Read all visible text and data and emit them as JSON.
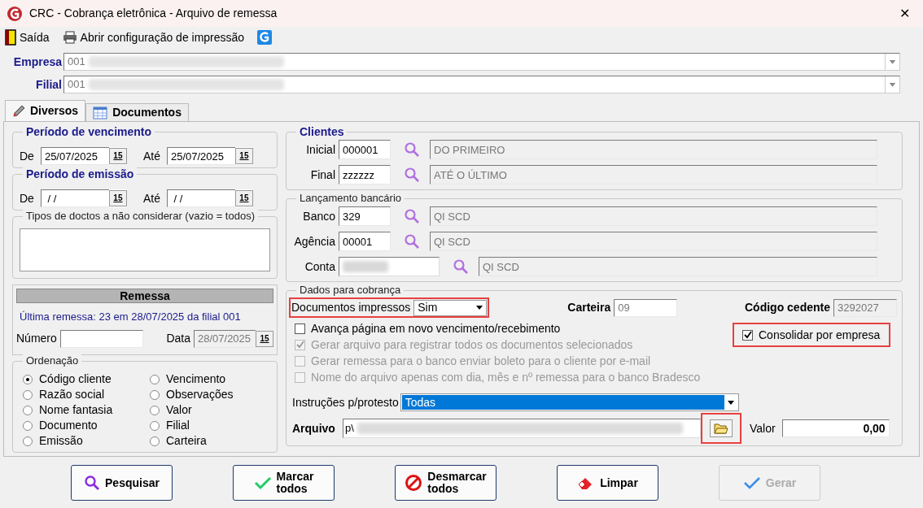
{
  "window": {
    "title": "CRC - Cobrança eletrônica - Arquivo de remessa",
    "close": "✕"
  },
  "toolbar": [
    {
      "kind": "exit",
      "label": "Saída"
    },
    {
      "kind": "print",
      "label": "Abrir configuração de impressão"
    },
    {
      "kind": "logo"
    }
  ],
  "company": {
    "empresa": {
      "label": "Empresa",
      "value": "001"
    },
    "filial": {
      "label": "Filial",
      "value": "001"
    }
  },
  "tabs": [
    {
      "kind": "pencil",
      "label": "Diversos",
      "selected": true
    },
    {
      "kind": "table",
      "label": "Documentos",
      "selected": false
    }
  ],
  "vencimento": {
    "title": "Período de vencimento",
    "from_label": "De",
    "from": "25/07/2025",
    "to_label": "Até",
    "to": "25/07/2025",
    "from_cal": "15",
    "to_cal": "15"
  },
  "emissao": {
    "title": "Período de emissão",
    "from_label": "De",
    "from": " / /",
    "to_label": "Até",
    "to": " / /",
    "from_cal": "15",
    "to_cal": "15"
  },
  "tipos": {
    "title": "Tipos de doctos a não considerar (vazio = todos)"
  },
  "remessa": {
    "title": "Remessa",
    "last": "Última remessa: 23 em 28/07/2025 da filial 001",
    "numero_label": "Número",
    "data_label": "Data",
    "data": "28/07/2025",
    "cal": "15"
  },
  "ordenacao": {
    "title": "Ordenação",
    "options": [
      {
        "label": "Código cliente",
        "selected": true
      },
      {
        "label": "Vencimento",
        "selected": false
      },
      {
        "label": "Razão social",
        "selected": false
      },
      {
        "label": "Observações",
        "selected": false
      },
      {
        "label": "Nome fantasia",
        "selected": false
      },
      {
        "label": "Valor",
        "selected": false
      },
      {
        "label": "Documento",
        "selected": false
      },
      {
        "label": "Filial",
        "selected": false
      },
      {
        "label": "Emissão",
        "selected": false
      },
      {
        "label": "Carteira",
        "selected": false
      }
    ]
  },
  "clientes": {
    "title": "Clientes",
    "rows": [
      {
        "label": "Inicial",
        "code": "000001",
        "name": "DO PRIMEIRO"
      },
      {
        "label": "Final",
        "code": "zzzzzz",
        "name": "ATÉ O ÚLTIMO"
      }
    ]
  },
  "lancamento": {
    "title": "Lançamento bancário",
    "rows": [
      {
        "label": "Banco",
        "code": "329",
        "name": "QI SCD"
      },
      {
        "label": "Agência",
        "code": "00001",
        "name": "QI SCD"
      },
      {
        "label": "Conta",
        "name": "QI SCD"
      }
    ]
  },
  "cobranca": {
    "title": "Dados para cobrança",
    "impressos": {
      "label": "Documentos impressos",
      "value": "Sim",
      "highlighted": true
    },
    "carteira": {
      "label": "Carteira",
      "value": "09"
    },
    "cedente": {
      "label": "Código cedente",
      "value": "3292027"
    },
    "checks": [
      {
        "label": "Avança página em novo vencimento/recebimento",
        "checked": false,
        "disabled": false
      },
      {
        "label": "Gerar arquivo para registrar todos os documentos selecionados",
        "checked": true,
        "disabled": true
      },
      {
        "label": "Gerar remessa para o banco enviar boleto para o cliente por e-mail",
        "checked": false,
        "disabled": true
      },
      {
        "label": "Nome do arquivo apenas com dia, mês e nº remessa para o banco Bradesco",
        "checked": false,
        "disabled": true
      }
    ],
    "consolidar": {
      "label": "Consolidar por empresa",
      "checked": true,
      "highlighted": true
    },
    "protesto": {
      "label": "Instruções p/protesto",
      "value": "Todas"
    },
    "arquivo": {
      "label": "Arquivo",
      "value": "p\\",
      "browse_highlighted": true
    },
    "valor": {
      "label": "Valor",
      "value": "0,00"
    }
  },
  "buttons": [
    {
      "kind": "search",
      "label": "Pesquisar",
      "disabled": false
    },
    {
      "kind": "check",
      "label": "Marcar todos",
      "disabled": false
    },
    {
      "kind": "block",
      "label": "Desmarcar todos",
      "disabled": false
    },
    {
      "kind": "eraser",
      "label": "Limpar",
      "disabled": false
    },
    {
      "kind": "check-blue",
      "label": "Gerar",
      "disabled": true
    }
  ]
}
